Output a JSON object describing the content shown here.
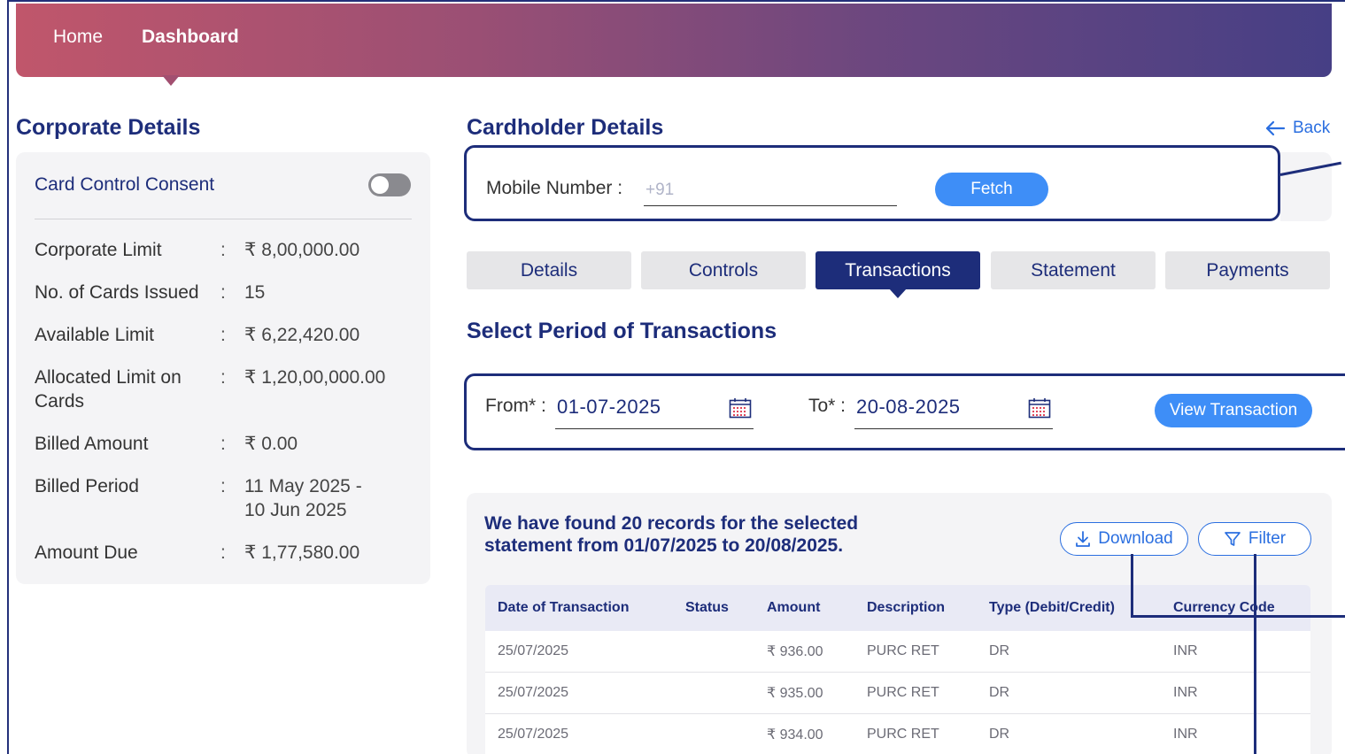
{
  "nav": {
    "home": "Home",
    "dashboard": "Dashboard"
  },
  "corporate": {
    "title": "Corporate Details",
    "consent_label": "Card Control Consent",
    "consent_enabled": false,
    "rows": [
      {
        "label": "Corporate Limit",
        "value": "₹ 8,00,000.00"
      },
      {
        "label": "No. of Cards Issued",
        "value": "15"
      },
      {
        "label": "Available Limit",
        "value": "₹ 6,22,420.00"
      },
      {
        "label": "Allocated Limit on Cards",
        "value": "₹ 1,20,00,000.00"
      },
      {
        "label": "Billed Amount",
        "value": "₹ 0.00"
      },
      {
        "label": "Billed Period",
        "value": "11 May 2025 - 10 Jun 2025"
      },
      {
        "label": "Amount Due",
        "value": "₹ 1,77,580.00"
      }
    ],
    "colon": ":"
  },
  "cardholder": {
    "title": "Cardholder Details",
    "back": "Back",
    "mobile_label": "Mobile Number :",
    "mobile_placeholder": "+91",
    "fetch": "Fetch"
  },
  "tabs": [
    {
      "label": "Details",
      "active": false
    },
    {
      "label": "Controls",
      "active": false
    },
    {
      "label": "Transactions",
      "active": true
    },
    {
      "label": "Statement",
      "active": false
    },
    {
      "label": "Payments",
      "active": false
    }
  ],
  "period": {
    "title": "Select Period of Transactions",
    "from_label": "From* :",
    "from_value": "01-07-2025",
    "to_label": "To* :",
    "to_value": "20-08-2025",
    "view_button": "View Transaction"
  },
  "results": {
    "summary": "We have found 20 records for the selected statement from 01/07/2025 to 20/08/2025.",
    "download": "Download",
    "filter": "Filter",
    "columns": [
      "Date of Transaction",
      "Status",
      "Amount",
      "Description",
      "Type (Debit/Credit)",
      "Currency Code"
    ],
    "rows": [
      [
        "25/07/2025",
        "",
        "₹ 936.00",
        "PURC RET",
        "DR",
        "INR"
      ],
      [
        "25/07/2025",
        "",
        "₹ 935.00",
        "PURC RET",
        "DR",
        "INR"
      ],
      [
        "25/07/2025",
        "",
        "₹ 934.00",
        "PURC RET",
        "DR",
        "INR"
      ]
    ]
  },
  "colors": {
    "primary": "#1d2d7a",
    "accent": "#3e8ef7",
    "link": "#2b6fe0"
  }
}
